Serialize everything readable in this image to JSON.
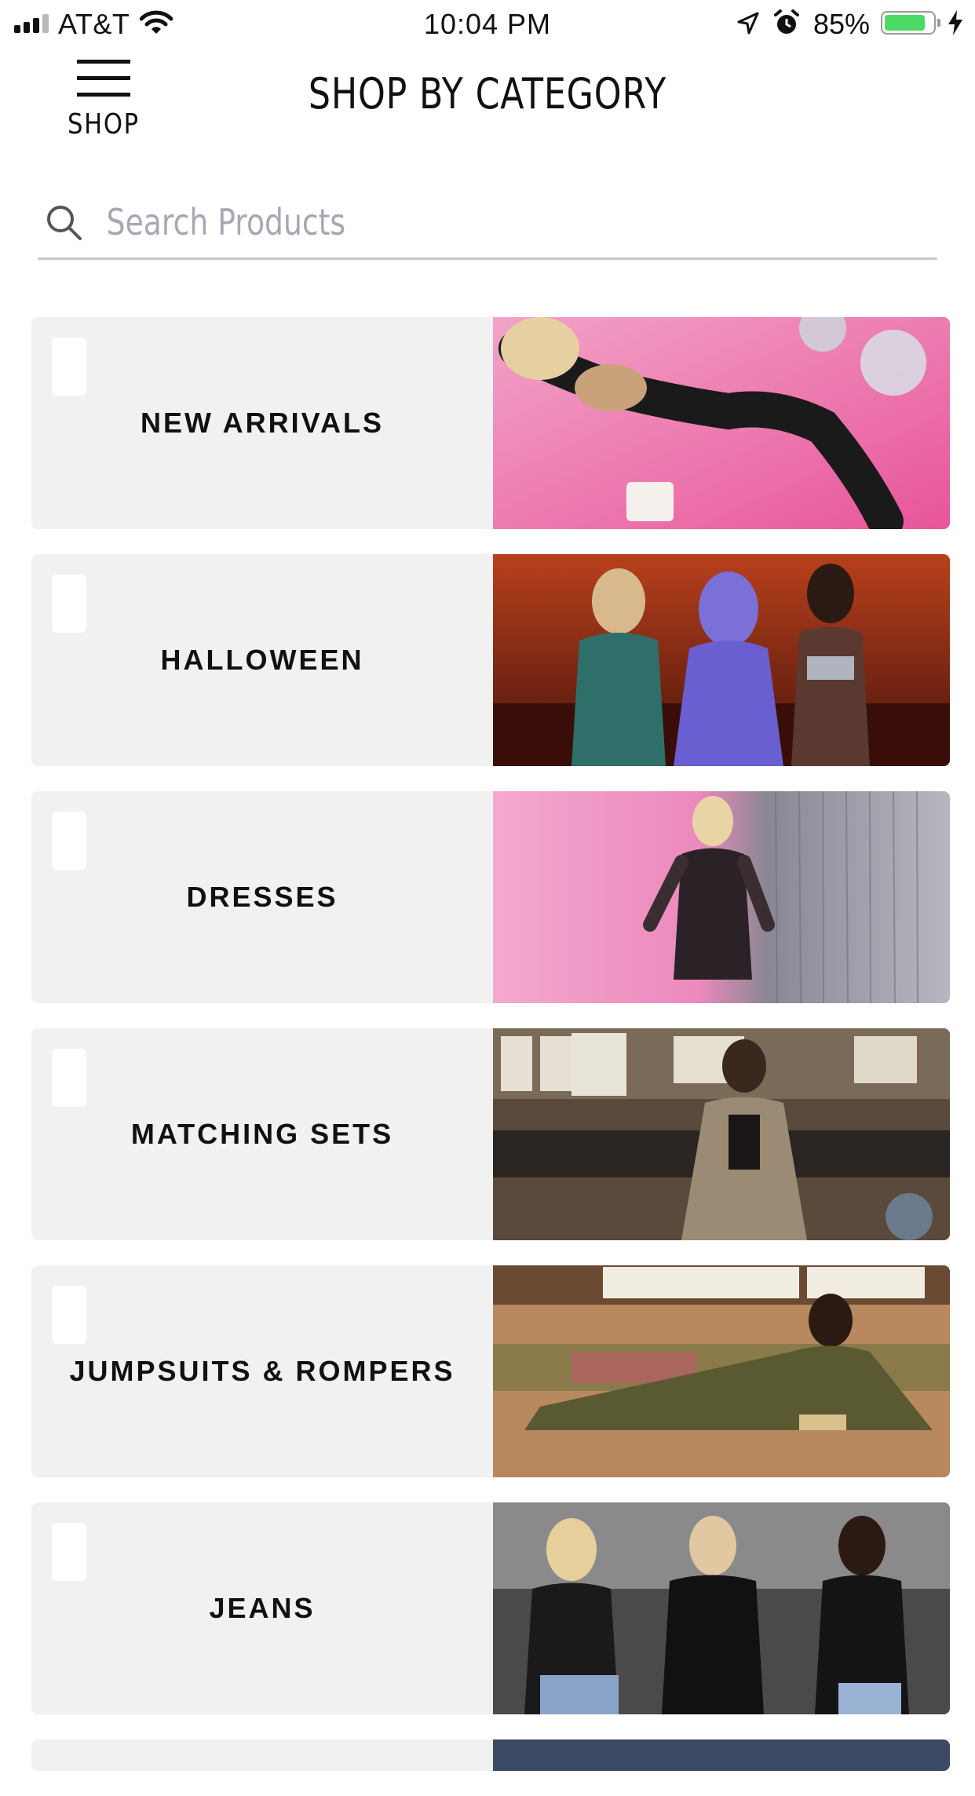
{
  "status_bar": {
    "carrier": "AT&T",
    "time": "10:04 PM",
    "battery_percent": "85%",
    "battery_level": 0.85,
    "battery_color": "#4cd964"
  },
  "header": {
    "menu_label": "SHOP",
    "title": "SHOP BY CATEGORY"
  },
  "search": {
    "placeholder": "Search Products",
    "value": ""
  },
  "categories": [
    {
      "label": "NEW ARRIVALS",
      "image": "photo-model-pink-fur-disco-balls"
    },
    {
      "label": "HALLOWEEN",
      "image": "photo-three-models-costumes-bar"
    },
    {
      "label": "DRESSES",
      "image": "photo-model-mesh-dress-pink-tinsel"
    },
    {
      "label": "MATCHING SETS",
      "image": "photo-model-snakeskin-set-bowling"
    },
    {
      "label": "JUMPSUITS & ROMPERS",
      "image": "photo-model-olive-jumpsuit"
    },
    {
      "label": "JEANS",
      "image": "photo-three-models-jeans-couch"
    }
  ]
}
